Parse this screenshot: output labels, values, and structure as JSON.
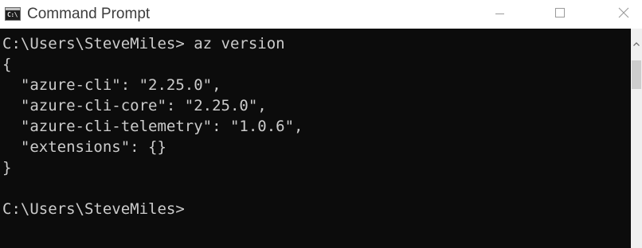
{
  "window": {
    "title": "Command Prompt",
    "icon": "cmd-app-icon",
    "icon_glyph": "C:\\",
    "controls": {
      "minimize": "minimize-icon",
      "maximize": "maximize-icon",
      "close": "close-icon"
    }
  },
  "console": {
    "lines": [
      "C:\\Users\\SteveMiles> az version",
      "{",
      "  \"azure-cli\": \"2.25.0\",",
      "  \"azure-cli-core\": \"2.25.0\",",
      "  \"azure-cli-telemetry\": \"1.0.6\",",
      "  \"extensions\": {}",
      "}",
      "",
      "C:\\Users\\SteveMiles>"
    ]
  },
  "colors": {
    "console_background": "#0c0c0c",
    "console_text": "#cccccc",
    "titlebar_background": "#ffffff"
  }
}
